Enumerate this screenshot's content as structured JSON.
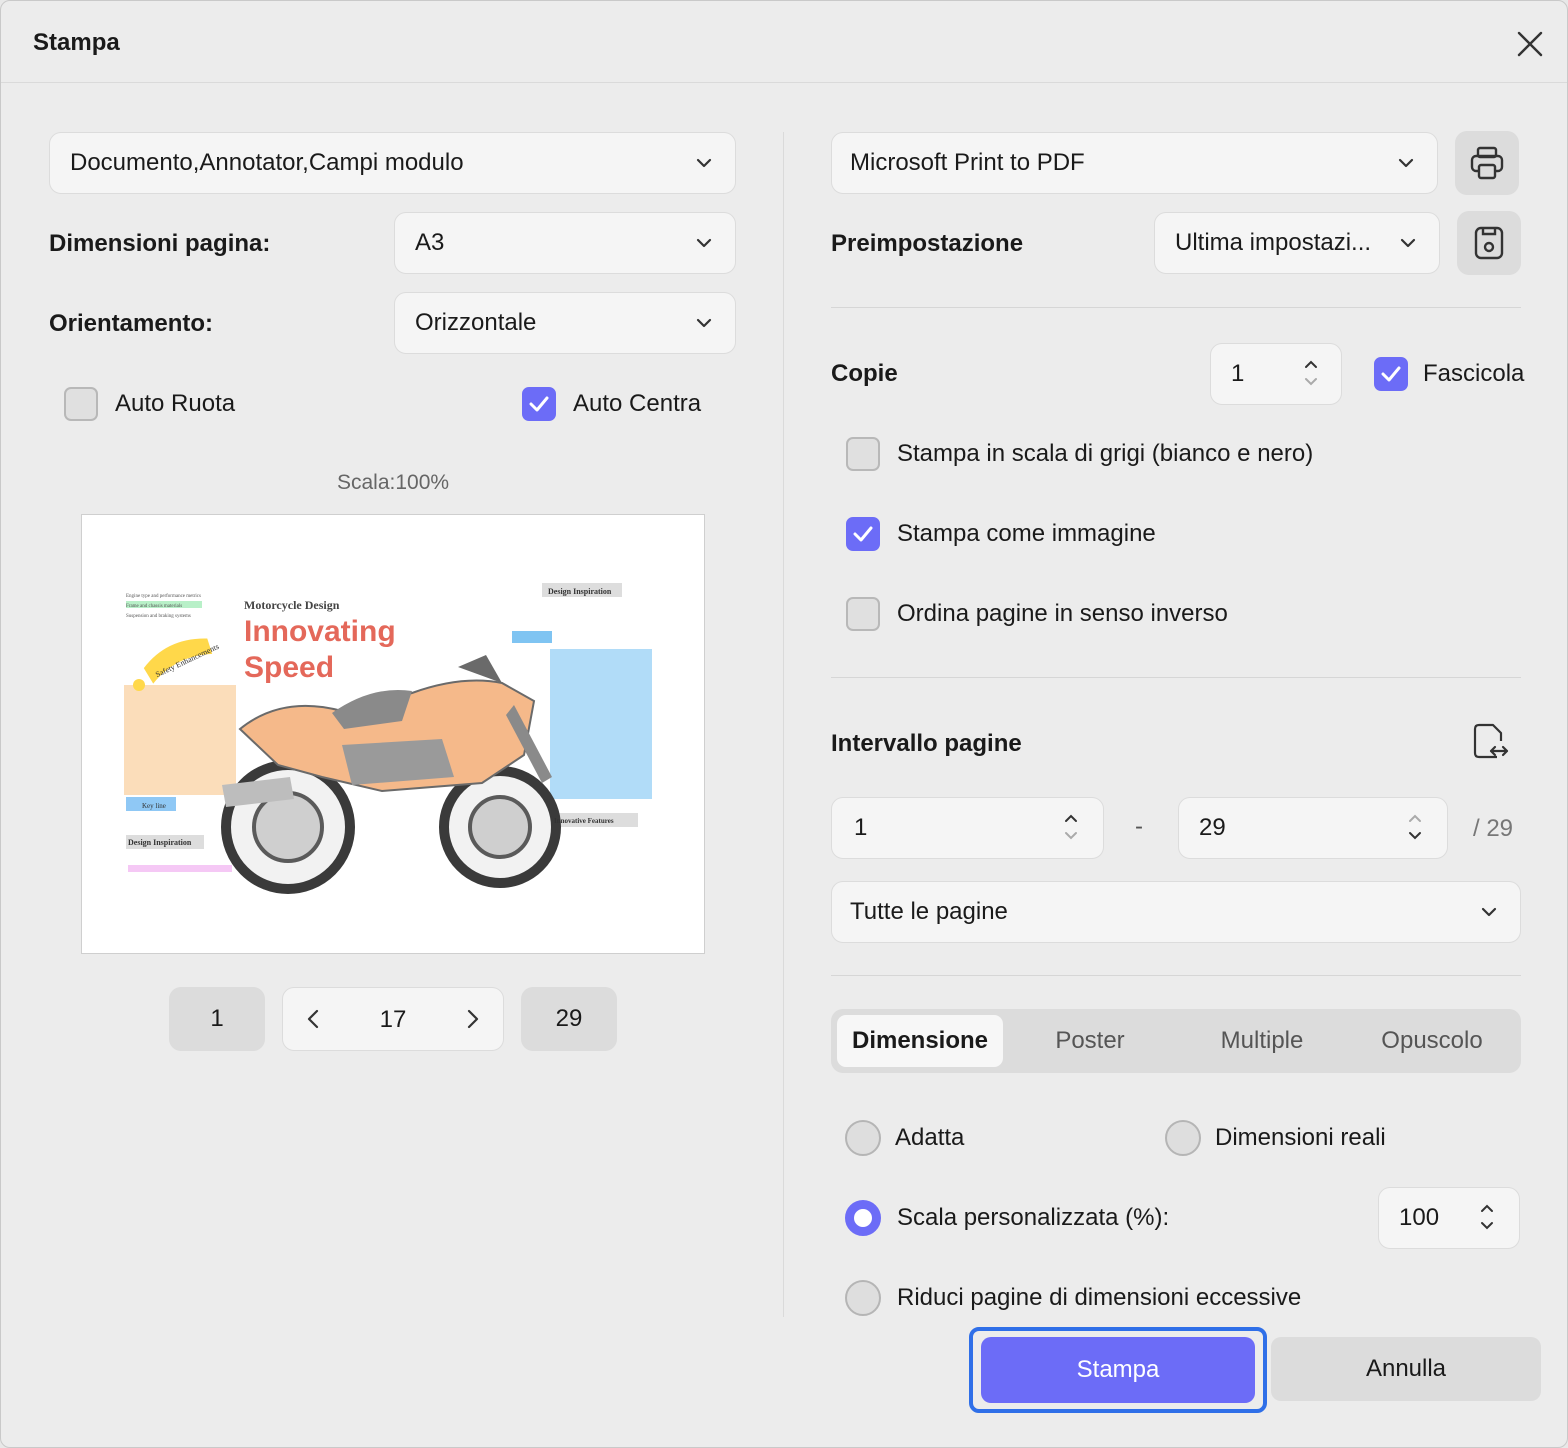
{
  "window": {
    "title": "Stampa"
  },
  "left": {
    "content_select": "Documento,Annotator,Campi modulo",
    "page_size_label": "Dimensioni pagina:",
    "page_size_value": "A3",
    "orientation_label": "Orientamento:",
    "orientation_value": "Orizzontale",
    "auto_rotate": {
      "label": "Auto Ruota",
      "checked": false
    },
    "auto_center": {
      "label": "Auto Centra",
      "checked": true
    },
    "scale_text": "Scala:100%",
    "preview": {
      "title_small": "Motorcycle Design",
      "title_big_1": "Innovating",
      "title_big_2": "Speed",
      "design_inspiration": "Design Inspiration",
      "innovative_features": "Innovative Features",
      "safety": "Safety Enhancements",
      "notes": [
        "Engine type and performance metrics",
        "Frame and chassis materials",
        "Suspension and braking systems"
      ],
      "keyline": "Key line"
    },
    "pager": {
      "first": "1",
      "current": "17",
      "last": "29"
    }
  },
  "right": {
    "printer": "Microsoft Print to PDF",
    "preset_label": "Preimpostazione",
    "preset_value": "Ultima impostazi...",
    "copies_label": "Copie",
    "copies_value": "1",
    "collate": {
      "label": "Fascicola",
      "checked": true
    },
    "grayscale": {
      "label": "Stampa in scala di grigi (bianco e nero)",
      "checked": false
    },
    "as_image": {
      "label": "Stampa come immagine",
      "checked": true
    },
    "reverse": {
      "label": "Ordina pagine in senso inverso",
      "checked": false
    },
    "range_label": "Intervallo pagine",
    "range_from": "1",
    "range_dash": "-",
    "range_to": "29",
    "range_total": "/ 29",
    "range_select": "Tutte le pagine",
    "tabs": [
      "Dimensione",
      "Poster",
      "Multiple",
      "Opuscolo"
    ],
    "active_tab": "Dimensione",
    "fit": "Adatta",
    "actual": "Dimensioni reali",
    "custom_scale": "Scala personalizzata (%):",
    "custom_scale_value": "100",
    "shrink": "Riduci pagine di dimensioni eccessive",
    "selected_option": "Scala personalizzata (%):"
  },
  "buttons": {
    "print": "Stampa",
    "cancel": "Annulla"
  },
  "colors": {
    "accent": "#6c6cf7",
    "focus": "#2f6fe8"
  }
}
